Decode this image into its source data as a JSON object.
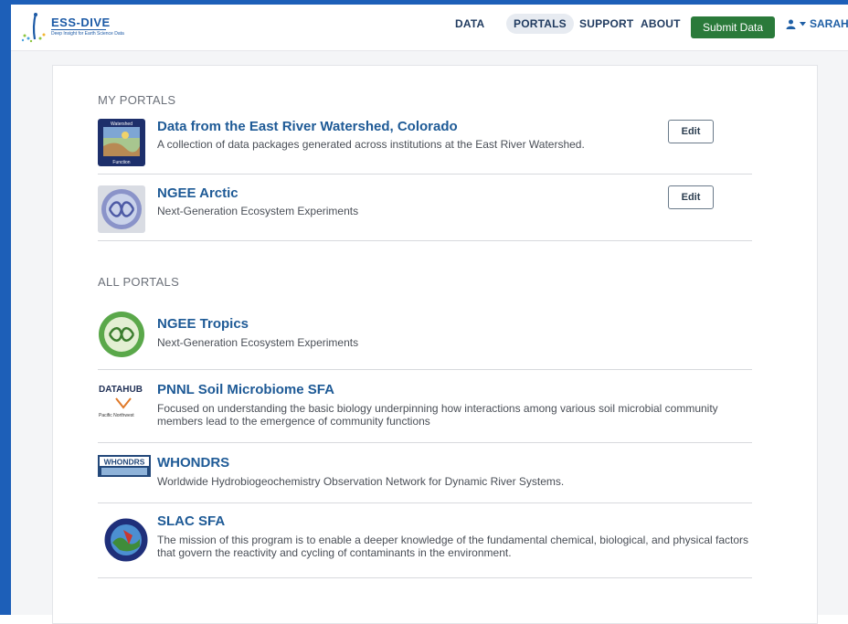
{
  "header": {
    "logo": {
      "title": "ESS-DIVE",
      "tagline": "Deep Insight for Earth Science Data"
    },
    "nav": [
      "DATA",
      "PORTALS",
      "SUPPORT",
      "ABOUT"
    ],
    "active_nav": "PORTALS",
    "submit_label": "Submit Data",
    "user_name": "SARAH",
    "colors": {
      "frame": "#1d5fb8",
      "submit": "#2a7a3a",
      "link": "#1e5a96"
    }
  },
  "my_portals": {
    "heading": "MY PORTALS",
    "items": [
      {
        "title": "Data from the East River Watershed, Colorado",
        "description": "A collection of data packages generated across institutions at the East River Watershed.",
        "edit_label": "Edit",
        "logo_text": [
          "Watershed",
          "Function"
        ]
      },
      {
        "title": "NGEE Arctic",
        "description": "Next-Generation Ecosystem Experiments",
        "edit_label": "Edit"
      }
    ]
  },
  "all_portals": {
    "heading": "ALL PORTALS",
    "items": [
      {
        "title": "NGEE Tropics",
        "description": "Next-Generation Ecosystem Experiments"
      },
      {
        "title": "PNNL Soil Microbiome SFA",
        "description": "Focused on understanding the basic biology underpinning how interactions among various soil microbial community members lead to the emergence of community functions",
        "logo_text": [
          "DATAHUB",
          "Pacific Northwest"
        ]
      },
      {
        "title": "WHONDRS",
        "description": "Worldwide Hydrobiogeochemistry Observation Network for Dynamic River Systems.",
        "logo_text": [
          "WHONDRS"
        ]
      },
      {
        "title": "SLAC SFA",
        "description": "The mission of this program is to enable a deeper knowledge of the fundamental chemical, biological, and physical factors that govern the reactivity and cycling of contaminants in the environment."
      }
    ]
  }
}
